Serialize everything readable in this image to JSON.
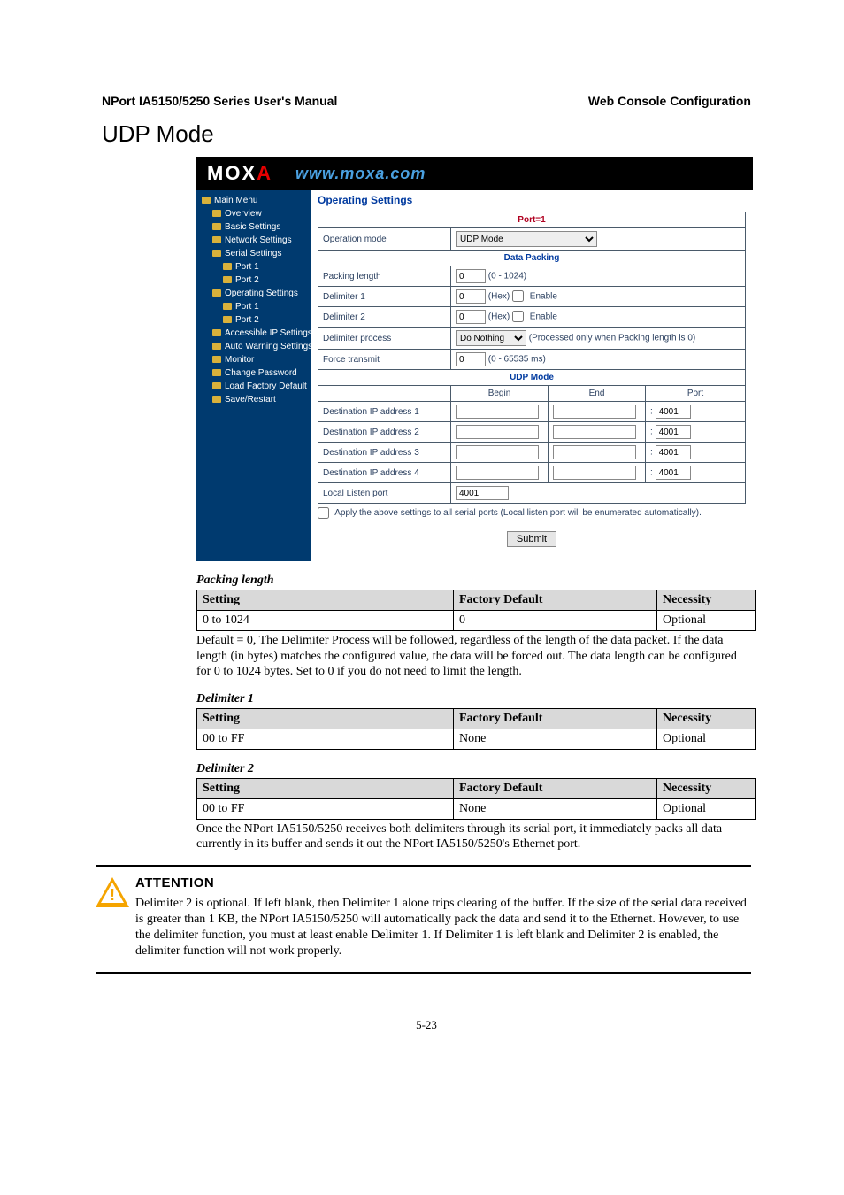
{
  "header": {
    "left": "NPort IA5150/5250 Series User's Manual",
    "right": "Web Console Configuration"
  },
  "title": "UDP Mode",
  "screenshot": {
    "brand": {
      "logo_a": "MOX",
      "logo_b": "A",
      "url": "www.moxa.com"
    },
    "nav": [
      {
        "label": "Main Menu",
        "cls": "lvl1"
      },
      {
        "label": "Overview",
        "cls": "lvl2"
      },
      {
        "label": "Basic Settings",
        "cls": "lvl2"
      },
      {
        "label": "Network Settings",
        "cls": "lvl2"
      },
      {
        "label": "Serial Settings",
        "cls": "lvl2"
      },
      {
        "label": "Port 1",
        "cls": "lvl3"
      },
      {
        "label": "Port 2",
        "cls": "lvl3"
      },
      {
        "label": "Operating Settings",
        "cls": "lvl2"
      },
      {
        "label": "Port 1",
        "cls": "lvl3"
      },
      {
        "label": "Port 2",
        "cls": "lvl3"
      },
      {
        "label": "Accessible IP Settings",
        "cls": "lvl2"
      },
      {
        "label": "Auto Warning Settings",
        "cls": "lvl2"
      },
      {
        "label": "Monitor",
        "cls": "lvl2"
      },
      {
        "label": "Change Password",
        "cls": "lvl2"
      },
      {
        "label": "Load Factory Default",
        "cls": "lvl2"
      },
      {
        "label": "Save/Restart",
        "cls": "lvl2"
      }
    ],
    "content": {
      "title": "Operating Settings",
      "port_header": "Port=1",
      "op_mode_label": "Operation mode",
      "op_mode_value": "UDP Mode",
      "data_packing": "Data Packing",
      "packing_length_label": "Packing length",
      "packing_length_value": "0",
      "packing_length_hint": "(0 - 1024)",
      "delim1_label": "Delimiter 1",
      "delim1_value": "0",
      "delim1_hint": "(Hex)",
      "delim1_enable": "Enable",
      "delim2_label": "Delimiter 2",
      "delim2_value": "0",
      "delim2_hint": "(Hex)",
      "delim2_enable": "Enable",
      "delim_proc_label": "Delimiter process",
      "delim_proc_value": "Do Nothing",
      "delim_proc_hint": "(Processed only when Packing length is 0)",
      "force_label": "Force transmit",
      "force_value": "0",
      "force_hint": "(0 - 65535 ms)",
      "udp_mode": "UDP Mode",
      "col_begin": "Begin",
      "col_end": "End",
      "col_port": "Port",
      "dest": [
        {
          "label": "Destination IP address 1",
          "begin": "",
          "end": "",
          "port": "4001"
        },
        {
          "label": "Destination IP address 2",
          "begin": "",
          "end": "",
          "port": "4001"
        },
        {
          "label": "Destination IP address 3",
          "begin": "",
          "end": "",
          "port": "4001"
        },
        {
          "label": "Destination IP address 4",
          "begin": "",
          "end": "",
          "port": "4001"
        }
      ],
      "local_listen_label": "Local Listen port",
      "local_listen_value": "4001",
      "apply_text": "Apply the above settings to all serial ports (Local listen port will be enumerated automatically).",
      "submit": "Submit"
    }
  },
  "tables": {
    "packing_length": {
      "caption": "Packing length",
      "headers": [
        "Setting",
        "Factory Default",
        "Necessity"
      ],
      "row": [
        "0 to 1024",
        "0",
        "Optional"
      ],
      "note": "Default = 0, The Delimiter Process will be followed, regardless of the length of the data packet. If the data length (in bytes) matches the configured value, the data will be forced out. The data length can be configured for 0 to 1024 bytes. Set to 0 if you do not need to limit the length."
    },
    "delim1": {
      "caption": "Delimiter 1",
      "headers": [
        "Setting",
        "Factory Default",
        "Necessity"
      ],
      "row": [
        "00 to FF",
        "None",
        "Optional"
      ]
    },
    "delim2": {
      "caption": "Delimiter 2",
      "headers": [
        "Setting",
        "Factory Default",
        "Necessity"
      ],
      "row": [
        "00 to FF",
        "None",
        "Optional"
      ],
      "note": "Once the NPort IA5150/5250 receives both delimiters through its serial port, it immediately packs all data currently in its buffer and sends it out the NPort IA5150/5250's Ethernet port."
    }
  },
  "attention": {
    "title": "ATTENTION",
    "body": "Delimiter 2 is optional. If left blank, then Delimiter 1 alone trips clearing of the buffer. If the size of the serial data received is greater than 1 KB, the NPort IA5150/5250 will automatically pack the data and send it to the Ethernet. However, to use the delimiter function, you must at least enable Delimiter 1. If Delimiter 1 is left blank and Delimiter 2 is enabled, the delimiter function will not work properly."
  },
  "page_number": "5-23"
}
